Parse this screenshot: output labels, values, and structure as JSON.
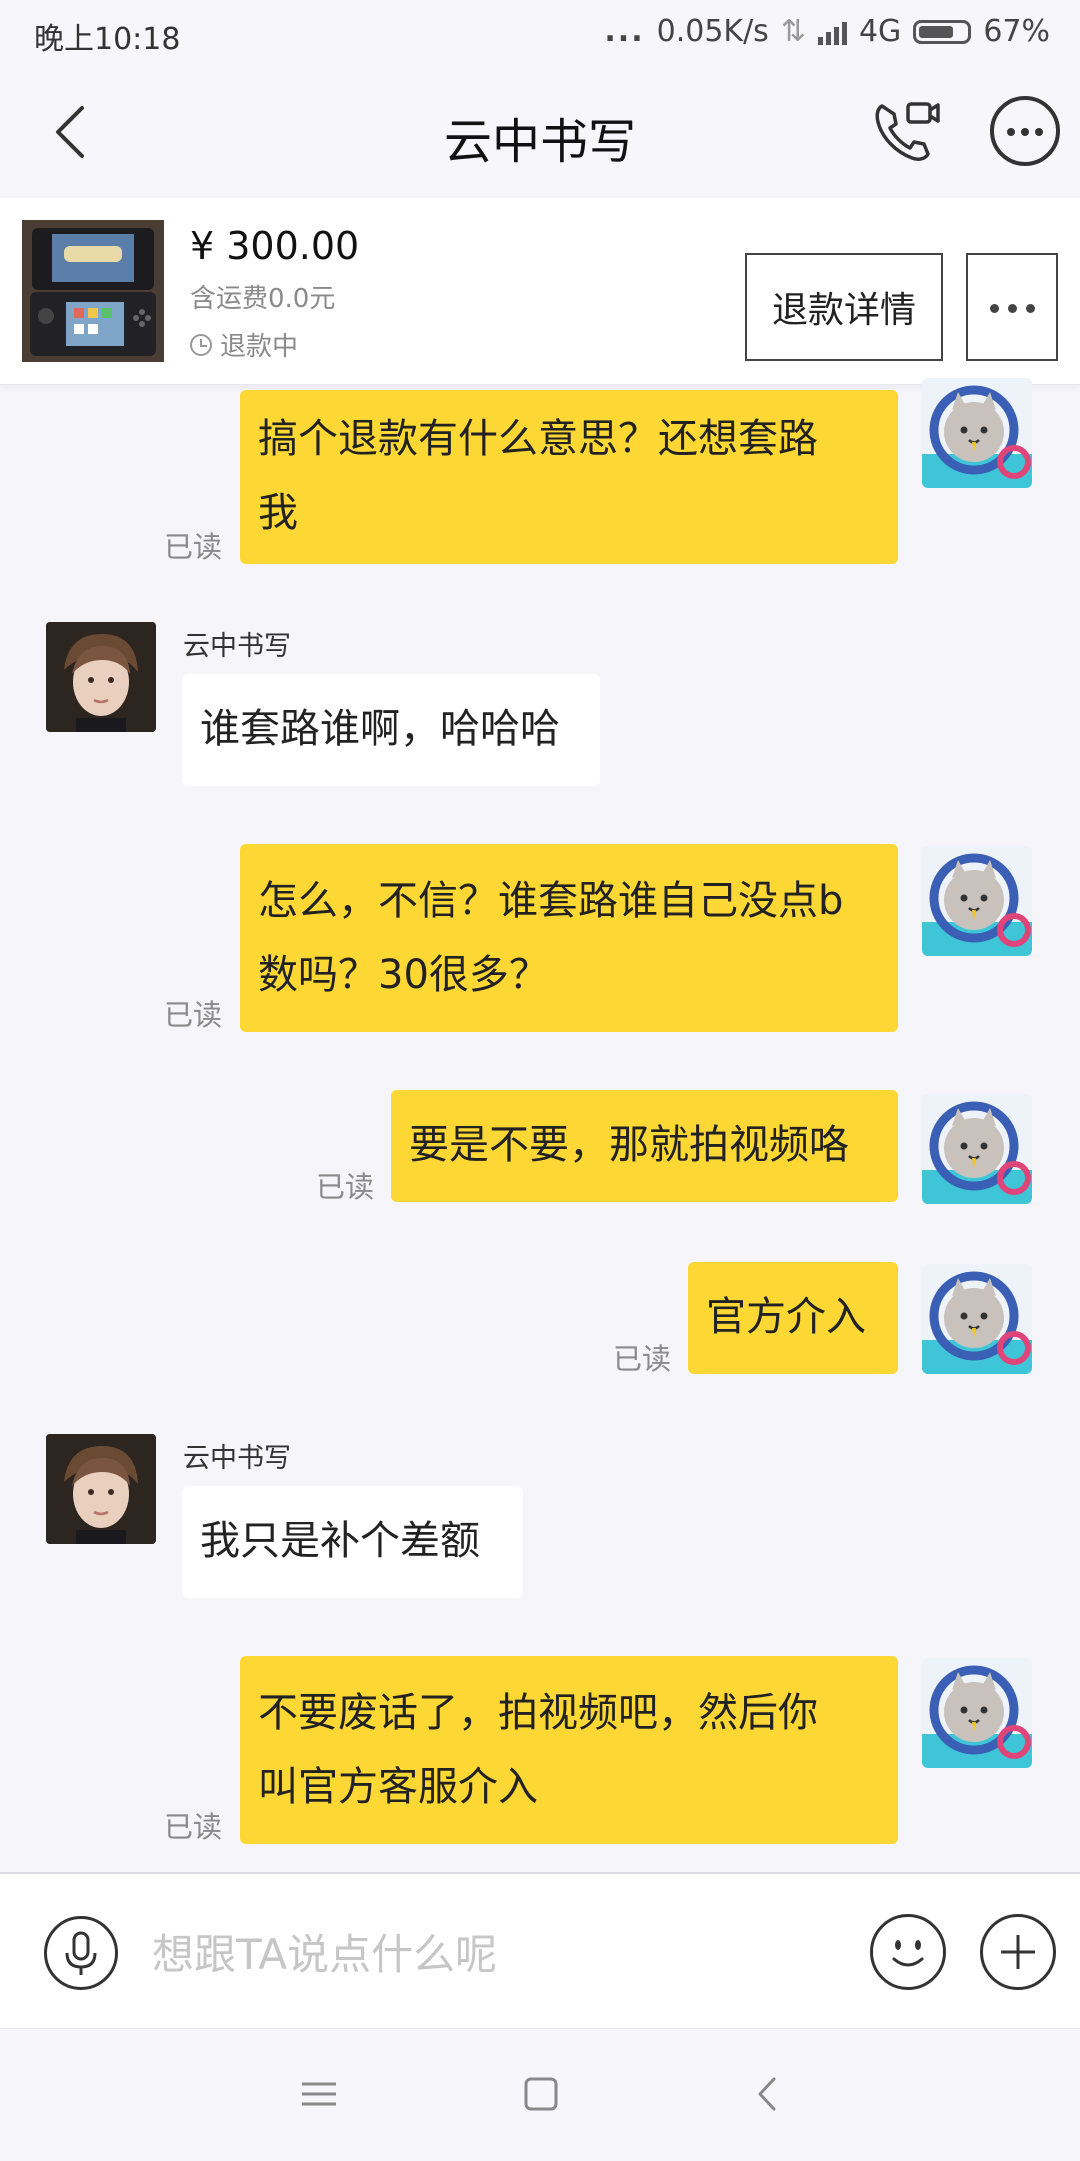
{
  "status_bar": {
    "time": "晚上10:18",
    "dots": "...",
    "speed": "0.05K/s",
    "network": "4G",
    "battery": "67%"
  },
  "header": {
    "title": "云中书写",
    "icons": [
      "back-arrow-icon",
      "phone-video-icon",
      "more-circle-icon"
    ]
  },
  "product": {
    "price": "¥ 300.00",
    "shipping": "含运费0.0元",
    "status": "退款中",
    "refund_detail_label": "退款详情",
    "more_label": "..."
  },
  "read_label": "已读",
  "messages": [
    {
      "from": "me",
      "text": "搞个退款有什么意思？还想套路\n我",
      "read": "已读"
    },
    {
      "from": "them",
      "sender": "云中书写",
      "text": "谁套路谁啊，哈哈哈"
    },
    {
      "from": "me",
      "text": "怎么，不信？谁套路谁自己没点b\n数吗？30很多？",
      "read": "已读"
    },
    {
      "from": "me",
      "text": "要是不要，那就拍视频咯",
      "read": "已读"
    },
    {
      "from": "me",
      "text": "官方介入",
      "read": "已读"
    },
    {
      "from": "them",
      "sender": "云中书写",
      "text": "我只是补个差额"
    },
    {
      "from": "me",
      "text": "不要废话了，拍视频吧，然后你\n叫官方客服介入",
      "read": "已读"
    }
  ],
  "input": {
    "placeholder": "想跟TA说点什么呢"
  },
  "colors": {
    "my_bubble": "#fdd835",
    "their_bubble": "#ffffff",
    "background": "#f5f5fa"
  }
}
